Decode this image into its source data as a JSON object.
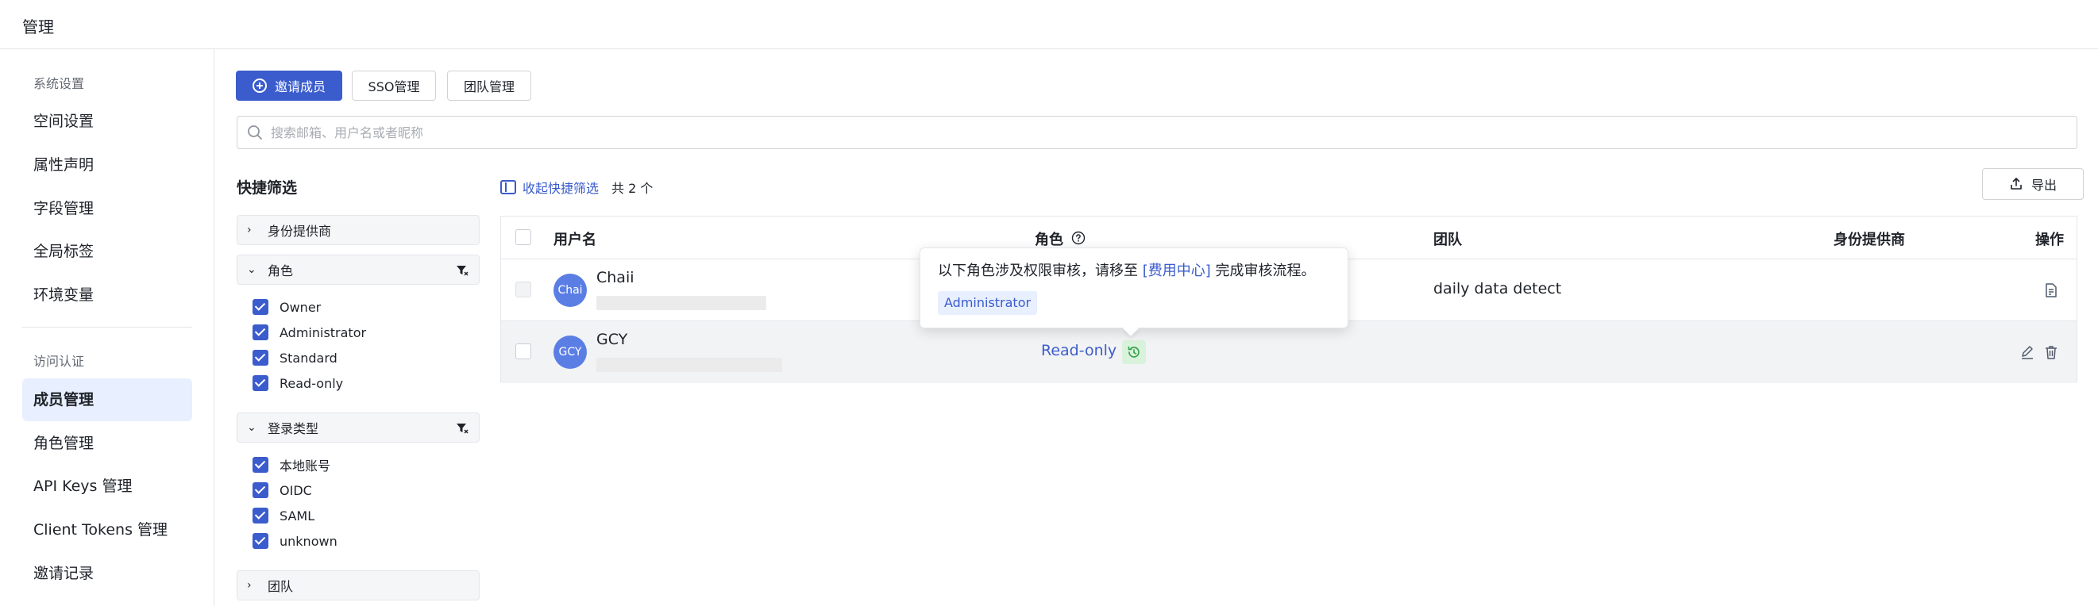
{
  "header": {
    "title": "管理"
  },
  "sidebar": {
    "groups": [
      {
        "label": "系统设置",
        "items": [
          "空间设置",
          "属性声明",
          "字段管理",
          "全局标签",
          "环境变量"
        ]
      },
      {
        "label": "访问认证",
        "items": [
          "成员管理",
          "角色管理",
          "API Keys 管理",
          "Client Tokens 管理",
          "邀请记录"
        ]
      }
    ],
    "active_item": "成员管理"
  },
  "toolbar": {
    "invite_label": "邀请成员",
    "sso_label": "SSO管理",
    "team_label": "团队管理"
  },
  "search": {
    "placeholder": "搜索邮箱、用户名或者昵称",
    "value": ""
  },
  "quick_filter": {
    "title": "快捷筛选",
    "sections": [
      {
        "label": "身份提供商",
        "expanded": false,
        "options": []
      },
      {
        "label": "角色",
        "expanded": true,
        "options": [
          "Owner",
          "Administrator",
          "Standard",
          "Read-only"
        ]
      },
      {
        "label": "登录类型",
        "expanded": true,
        "options": [
          "本地账号",
          "OIDC",
          "SAML",
          "unknown"
        ]
      },
      {
        "label": "团队",
        "expanded": false,
        "options": []
      }
    ]
  },
  "list": {
    "collapse_label": "收起快捷筛选",
    "count_label": "共 2 个",
    "export_label": "导出"
  },
  "table": {
    "columns": [
      "用户名",
      "角色",
      "团队",
      "身份提供商",
      "操作"
    ],
    "rows": [
      {
        "avatar": "Chai",
        "name": "Chaii",
        "role": "",
        "team": "daily data detect",
        "provider": ""
      },
      {
        "avatar": "GCY",
        "name": "GCY",
        "role": "Read-only",
        "team": "",
        "provider": ""
      }
    ]
  },
  "popover": {
    "message_prefix": "以下角色涉及权限审核，请移至",
    "link": "[费用中心]",
    "message_suffix": "完成审核流程。",
    "tag": "Administrator"
  },
  "colors": {
    "primary": "#3b5ccc",
    "active_bg": "#e8effe",
    "review_icon_bg": "#d9f2dc",
    "avatar": "#5b7ee5"
  }
}
